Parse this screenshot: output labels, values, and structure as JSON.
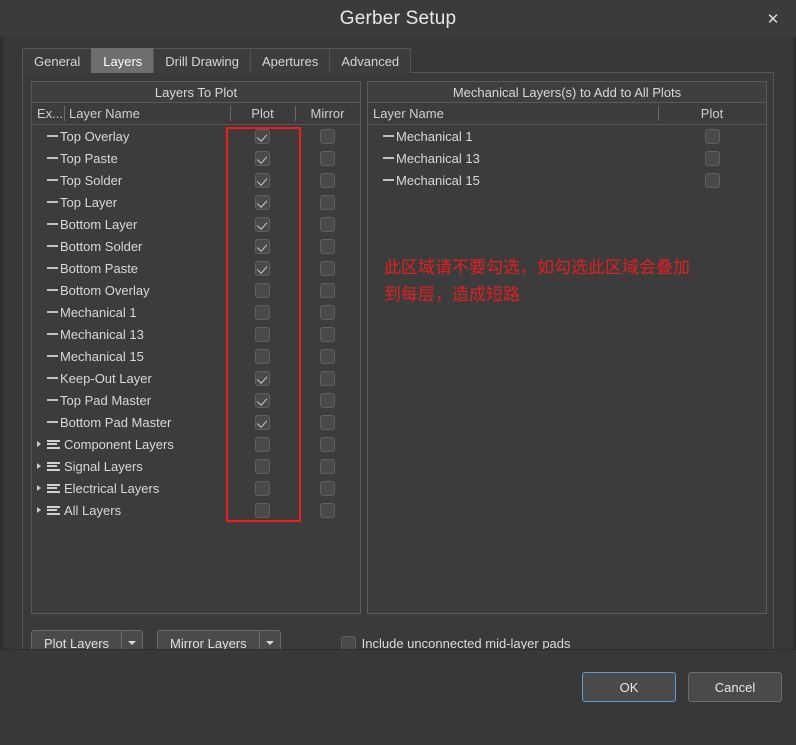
{
  "window": {
    "title": "Gerber Setup",
    "close_icon": "close-icon"
  },
  "tabs": [
    {
      "label": "General",
      "active": false
    },
    {
      "label": "Layers",
      "active": true
    },
    {
      "label": "Drill Drawing",
      "active": false
    },
    {
      "label": "Apertures",
      "active": false
    },
    {
      "label": "Advanced",
      "active": false
    }
  ],
  "left_panel": {
    "title": "Layers To Plot",
    "columns": {
      "extended": "Ex...",
      "layer_name": "Layer Name",
      "plot": "Plot",
      "mirror": "Mirror"
    },
    "rows": [
      {
        "label": "Top Overlay",
        "type": "leaf",
        "plot": true,
        "mirror": false
      },
      {
        "label": "Top Paste",
        "type": "leaf",
        "plot": true,
        "mirror": false
      },
      {
        "label": "Top Solder",
        "type": "leaf",
        "plot": true,
        "mirror": false
      },
      {
        "label": "Top Layer",
        "type": "leaf",
        "plot": true,
        "mirror": false
      },
      {
        "label": "Bottom Layer",
        "type": "leaf",
        "plot": true,
        "mirror": false
      },
      {
        "label": "Bottom Solder",
        "type": "leaf",
        "plot": true,
        "mirror": false
      },
      {
        "label": "Bottom Paste",
        "type": "leaf",
        "plot": true,
        "mirror": false
      },
      {
        "label": "Bottom Overlay",
        "type": "leaf",
        "plot": false,
        "mirror": false
      },
      {
        "label": "Mechanical 1",
        "type": "leaf",
        "plot": false,
        "mirror": false
      },
      {
        "label": "Mechanical 13",
        "type": "leaf",
        "plot": false,
        "mirror": false
      },
      {
        "label": "Mechanical 15",
        "type": "leaf",
        "plot": false,
        "mirror": false
      },
      {
        "label": "Keep-Out Layer",
        "type": "leaf",
        "plot": true,
        "mirror": false
      },
      {
        "label": "Top Pad Master",
        "type": "leaf",
        "plot": true,
        "mirror": false
      },
      {
        "label": "Bottom Pad Master",
        "type": "leaf",
        "plot": true,
        "mirror": false
      },
      {
        "label": "Component Layers",
        "type": "group",
        "plot": false,
        "mirror": false
      },
      {
        "label": "Signal Layers",
        "type": "group",
        "plot": false,
        "mirror": false
      },
      {
        "label": "Electrical Layers",
        "type": "group",
        "plot": false,
        "mirror": false
      },
      {
        "label": "All Layers",
        "type": "group",
        "plot": false,
        "mirror": false
      }
    ]
  },
  "right_panel": {
    "title": "Mechanical Layers(s) to Add to All Plots",
    "columns": {
      "layer_name": "Layer Name",
      "plot": "Plot"
    },
    "rows": [
      {
        "label": "Mechanical 1",
        "type": "leaf",
        "plot": false
      },
      {
        "label": "Mechanical 13",
        "type": "leaf",
        "plot": false
      },
      {
        "label": "Mechanical 15",
        "type": "leaf",
        "plot": false
      }
    ],
    "annotation": {
      "line1": "此区域请不要勾选，如勾选此区域会叠加",
      "line2": "到每层，造成短路",
      "color": "#e02020"
    }
  },
  "highlight": {
    "color": "#ee1c1c",
    "target": "plot-column-checkboxes"
  },
  "bottom": {
    "plot_layers": {
      "mnemonic": "P",
      "rest": "lot Layers"
    },
    "mirror_layers": {
      "mnemonic": "M",
      "rest": "irror Layers"
    },
    "include_pads": {
      "checked": false,
      "mnemonic": "I",
      "rest": "nclude unconnected mid-layer pads"
    }
  },
  "footer": {
    "ok_label": "OK",
    "cancel_label": "Cancel"
  }
}
